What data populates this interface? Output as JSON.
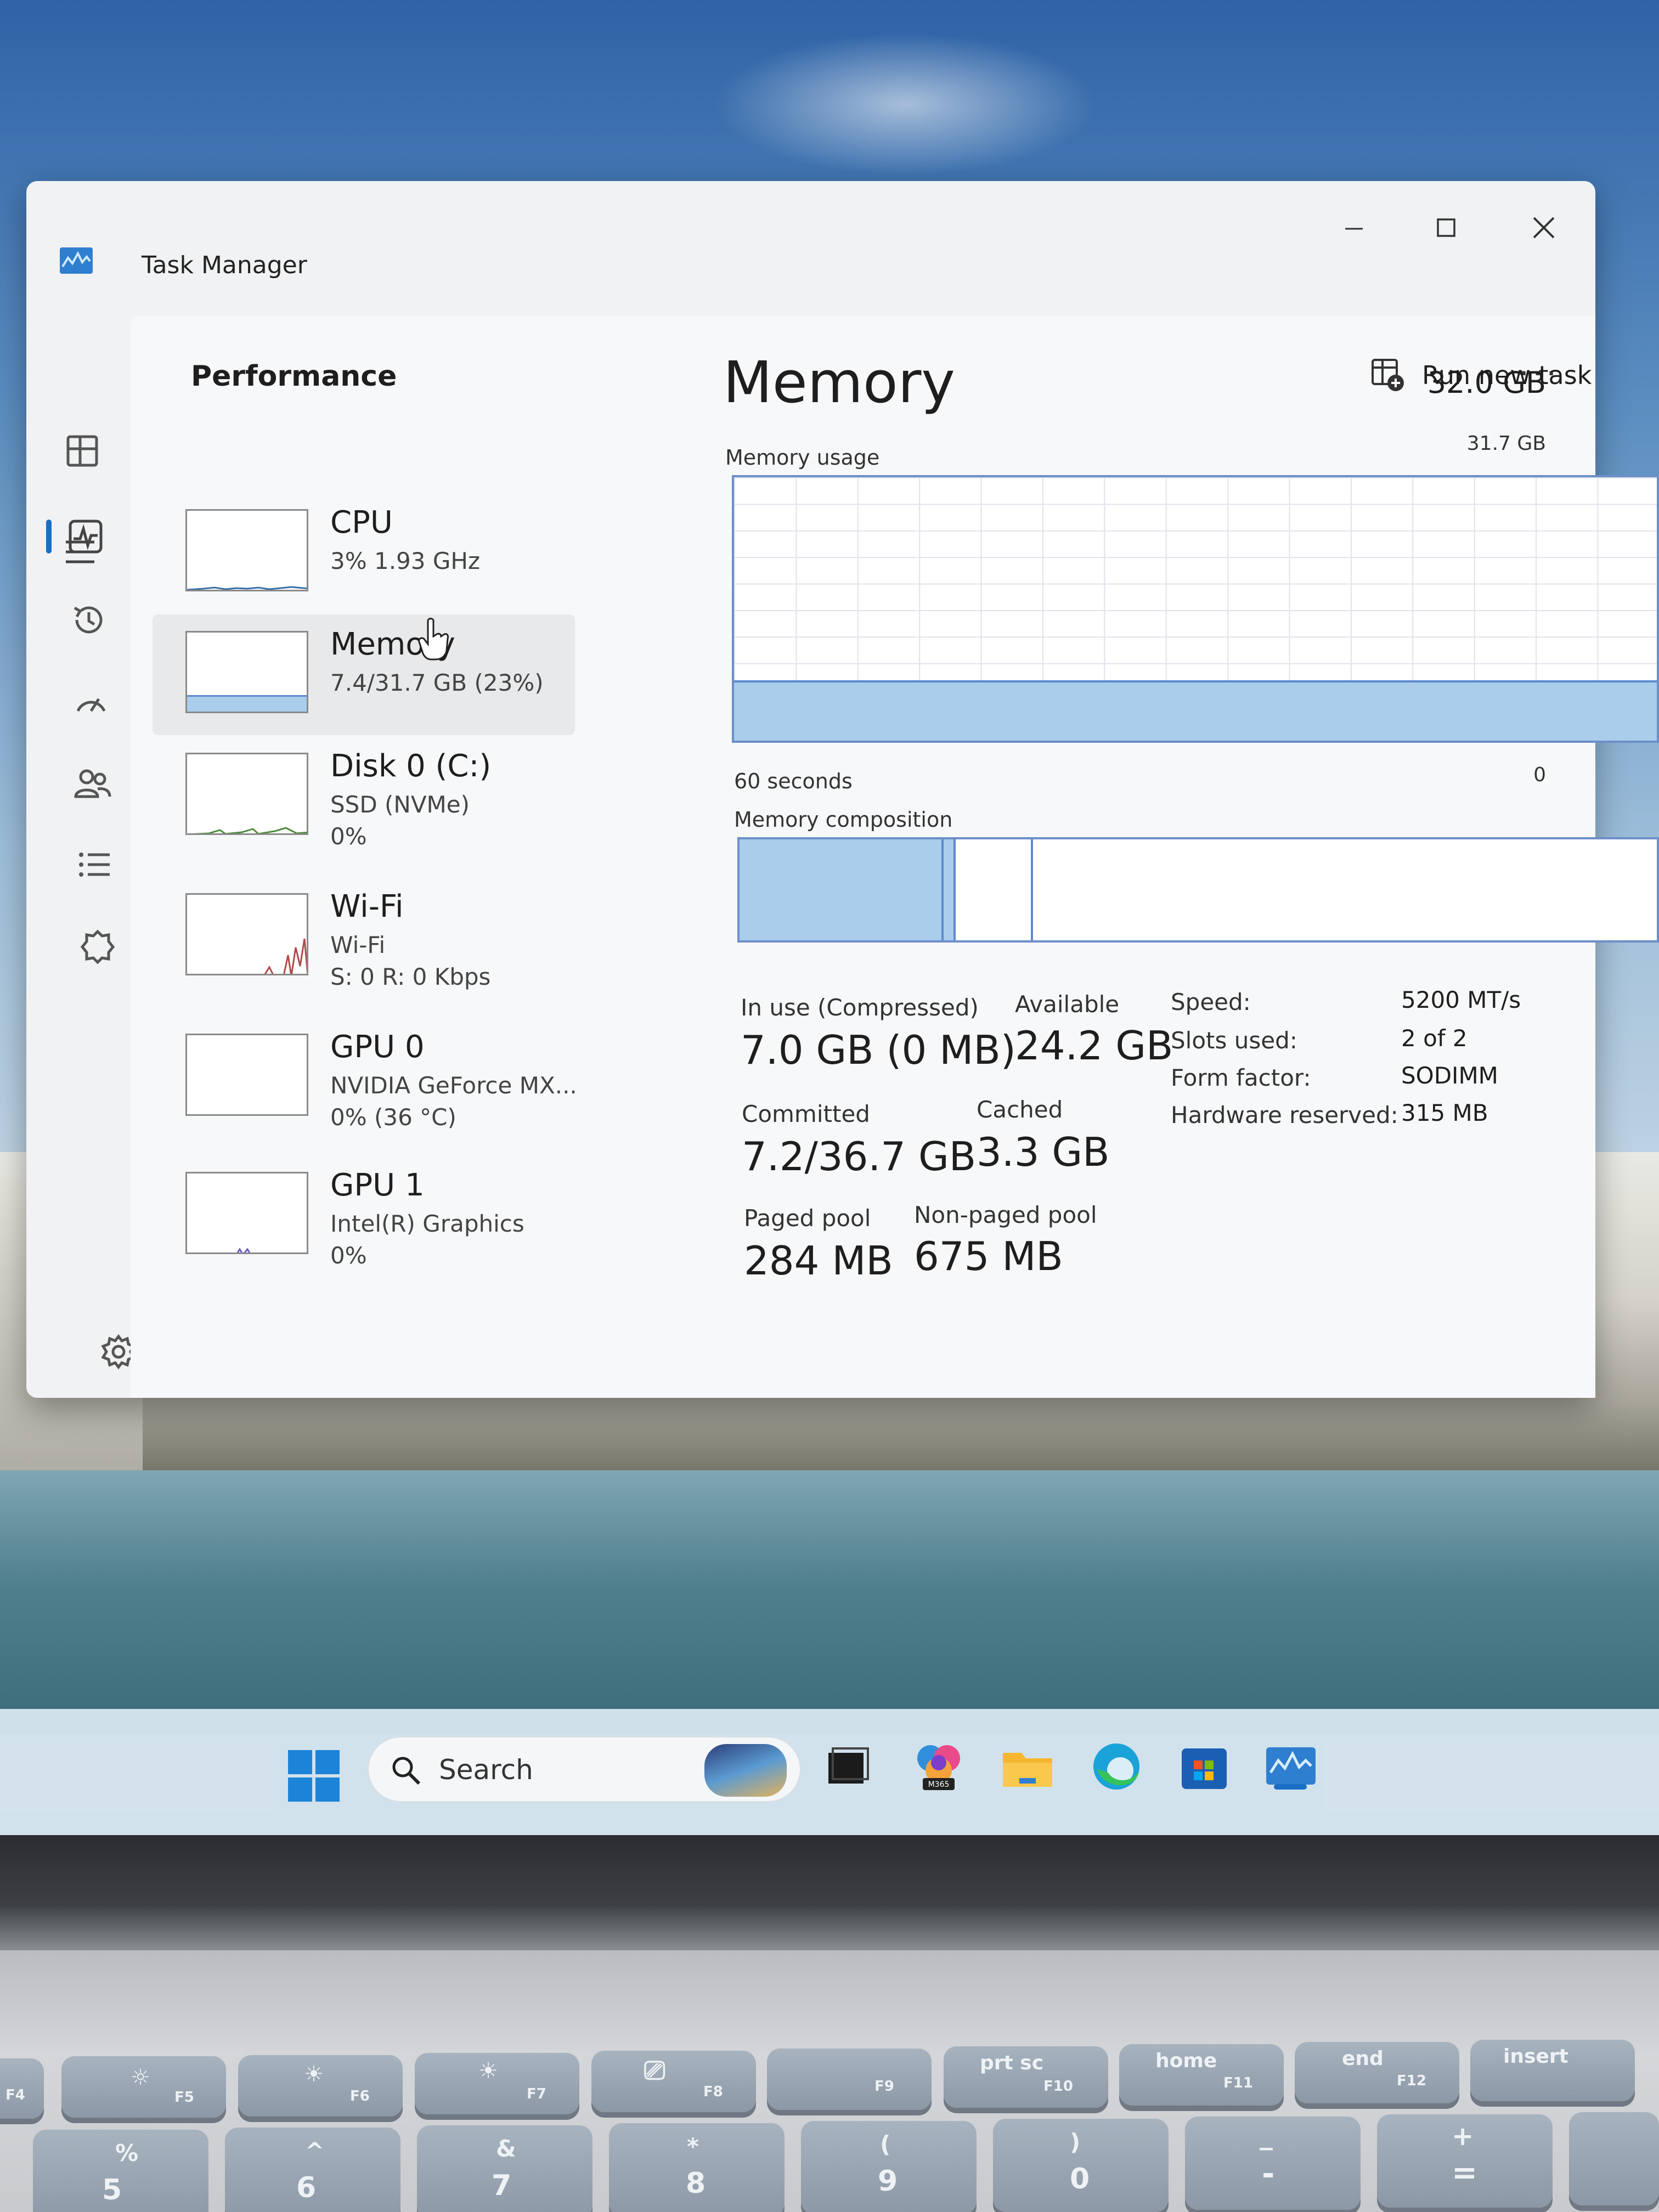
{
  "window": {
    "title": "Task Manager"
  },
  "header": {
    "section_title": "Performance",
    "run_task_label": "Run new task",
    "more_label": "···"
  },
  "devices": [
    {
      "name": "CPU",
      "line1": "3% 1.93 GHz",
      "line2": ""
    },
    {
      "name": "Memory",
      "line1": "7.4/31.7 GB (23%)",
      "line2": ""
    },
    {
      "name": "Disk 0 (C:)",
      "line1": "SSD (NVMe)",
      "line2": "0%"
    },
    {
      "name": "Wi-Fi",
      "line1": "Wi-Fi",
      "line2": "S: 0 R: 0 Kbps"
    },
    {
      "name": "GPU 0",
      "line1": "NVIDIA GeForce MX...",
      "line2": "0% (36 °C)"
    },
    {
      "name": "GPU 1",
      "line1": "Intel(R) Graphics",
      "line2": "0%"
    }
  ],
  "memory": {
    "title": "Memory",
    "total": "32.0 GB",
    "usage_label": "Memory usage",
    "usage_max": "31.7 GB",
    "usage_fraction": 0.23,
    "time_label": "60 seconds",
    "zero_label": "0",
    "composition_label": "Memory composition",
    "composition": {
      "in_use_fraction": 0.22,
      "modified_fraction": 0.013,
      "standby_fraction": 0.087
    },
    "stats": {
      "in_use_label": "In use (Compressed)",
      "in_use_value": "7.0 GB (0 MB)",
      "available_label": "Available",
      "available_value": "24.2 GB",
      "committed_label": "Committed",
      "committed_value": "7.2/36.7 GB",
      "cached_label": "Cached",
      "cached_value": "3.3 GB",
      "paged_label": "Paged pool",
      "paged_value": "284 MB",
      "nonpaged_label": "Non-paged pool",
      "nonpaged_value": "675 MB"
    },
    "details": [
      {
        "label": "Speed:",
        "value": "5200 MT/s"
      },
      {
        "label": "Slots used:",
        "value": "2 of 2"
      },
      {
        "label": "Form factor:",
        "value": "SODIMM"
      },
      {
        "label": "Hardware reserved:",
        "value": "315 MB"
      }
    ]
  },
  "taskbar": {
    "search_label": "Search",
    "office_badge": "M365"
  },
  "keyboard": {
    "fn_keys": [
      "F4",
      "F5",
      "F6",
      "F7",
      "F8",
      "F9",
      "prt sc",
      "home",
      "end",
      "insert"
    ],
    "fn_sublabels": [
      "F10",
      "F11",
      "F12"
    ],
    "number_keys": [
      {
        "top": "%",
        "bottom": "5"
      },
      {
        "top": "^",
        "bottom": "6"
      },
      {
        "top": "&",
        "bottom": "7"
      },
      {
        "top": "*",
        "bottom": "8"
      },
      {
        "top": "(",
        "bottom": "9"
      },
      {
        "top": ")",
        "bottom": "0"
      },
      {
        "top": "_",
        "bottom": "-"
      },
      {
        "top": "+",
        "bottom": "="
      }
    ]
  },
  "colors": {
    "accent": "#1a6fc4",
    "memory_fill": "#a9cdeb",
    "memory_line": "#5d8ad0",
    "graph_border": "#6d8fc9"
  }
}
